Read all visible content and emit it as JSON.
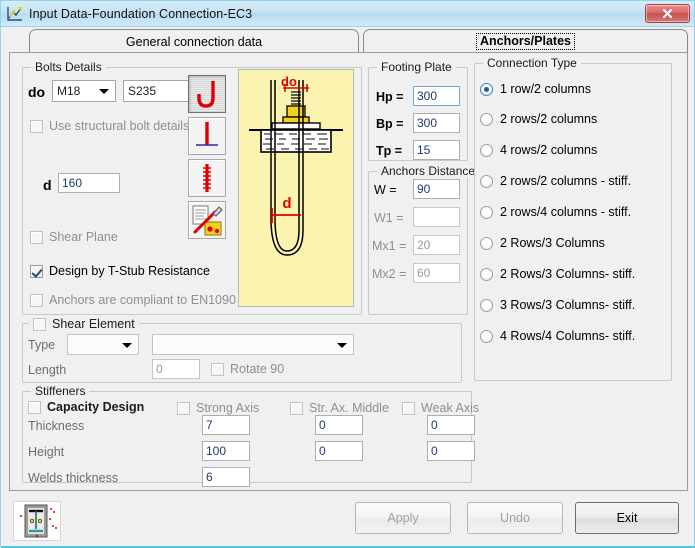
{
  "window": {
    "title": "Input Data-Foundation Connection-EC3",
    "app_icon": "chart-app-icon",
    "close_label": "✖"
  },
  "tabs": [
    {
      "label": "General connection data",
      "active": false,
      "name": "tab-general-connection-data"
    },
    {
      "label": "Anchors/Plates",
      "active": true,
      "name": "tab-anchors-plates"
    }
  ],
  "bolts_details": {
    "legend": "Bolts Details",
    "do_label": "do",
    "diameter_value": "M18",
    "grade_value": "S235",
    "use_structural_bolt_details": {
      "label": "Use structural bolt details",
      "checked": false
    },
    "d_label": "d",
    "d_value": "160",
    "shear_plane": {
      "label": "Shear Plane",
      "checked": false
    },
    "design_by_tstub": {
      "label": "Design by T-Stub Resistance",
      "checked": true
    },
    "anchors_en1090": {
      "label": "Anchors are compliant to EN1090",
      "checked": false
    },
    "anchor_type_buttons": [
      {
        "name": "anchor-j-hook-icon",
        "selected": true
      },
      {
        "name": "anchor-t-head-icon",
        "selected": false
      },
      {
        "name": "anchor-threaded-rod-icon",
        "selected": false
      },
      {
        "name": "anchor-settings-tools-icon",
        "selected": false
      }
    ],
    "preview": {
      "name": "anchor-bolt-diagram",
      "label_do": "do",
      "label_d": "d"
    }
  },
  "footing_plate": {
    "legend": "Footing Plate",
    "fields": [
      {
        "label": "Hp =",
        "value": "300",
        "disabled": false,
        "name": "hp-field"
      },
      {
        "label": "Bp =",
        "value": "300",
        "disabled": false,
        "name": "bp-field"
      },
      {
        "label": "Tp =",
        "value": "15",
        "disabled": false,
        "name": "tp-field"
      }
    ]
  },
  "anchors_distance": {
    "legend": "Anchors Distance",
    "fields": [
      {
        "label": "W =",
        "value": "90",
        "disabled": false,
        "name": "w-field"
      },
      {
        "label": "W1 =",
        "value": "",
        "disabled": true,
        "name": "w1-field"
      },
      {
        "label": "Mx1 =",
        "value": "20",
        "disabled": true,
        "name": "mx1-field"
      },
      {
        "label": "Mx2 =",
        "value": "60",
        "disabled": true,
        "name": "mx2-field"
      }
    ]
  },
  "connection_type": {
    "legend": "Connection Type",
    "options": [
      {
        "label": "1 row/2 columns",
        "selected": true
      },
      {
        "label": "2 rows/2 columns",
        "selected": false
      },
      {
        "label": "4 rows/2 columns",
        "selected": false
      },
      {
        "label": "2 rows/2 columns - stiff.",
        "selected": false
      },
      {
        "label": "2 rows/4 columns - stiff.",
        "selected": false
      },
      {
        "label": "2 Rows/3 Columns",
        "selected": false
      },
      {
        "label": "2 Rows/3 Columns- stiff.",
        "selected": false
      },
      {
        "label": "3 Rows/3 Columns- stiff.",
        "selected": false
      },
      {
        "label": "4 Rows/4 Columns- stiff.",
        "selected": false
      }
    ]
  },
  "shear_element": {
    "legend": "Shear Element",
    "checked": false,
    "type_label": "Type",
    "type_value": "",
    "profile_value": "",
    "length_label": "Length",
    "length_value": "0",
    "rotate90": {
      "label": "Rotate 90",
      "checked": false
    }
  },
  "stiffeners": {
    "legend": "Stiffeners",
    "capacity_design": {
      "label": "Capacity Design",
      "checked": false
    },
    "columns": [
      {
        "label": "Strong Axis",
        "checked": false
      },
      {
        "label": "Str. Ax. Middle",
        "checked": false
      },
      {
        "label": "Weak Axis",
        "checked": false
      }
    ],
    "rows": [
      {
        "label": "Thickness",
        "values": [
          "7",
          "0",
          "0"
        ]
      },
      {
        "label": "Height",
        "values": [
          "100",
          "0",
          "0"
        ]
      },
      {
        "label": "Welds thickness",
        "values": [
          "6",
          "",
          ""
        ]
      }
    ]
  },
  "footer": {
    "apply_label": "Apply",
    "undo_label": "Undo",
    "exit_label": "Exit",
    "thumbnail_name": "connection-preview-thumbnail"
  },
  "colors": {
    "titlebar": "#c6e4f4",
    "close_button": "#c84f4f",
    "panel": "#f0f0f0",
    "preview_bg": "#fbf4b0",
    "accent_red": "#e00000",
    "bottom_strip": "#49c8e8"
  }
}
